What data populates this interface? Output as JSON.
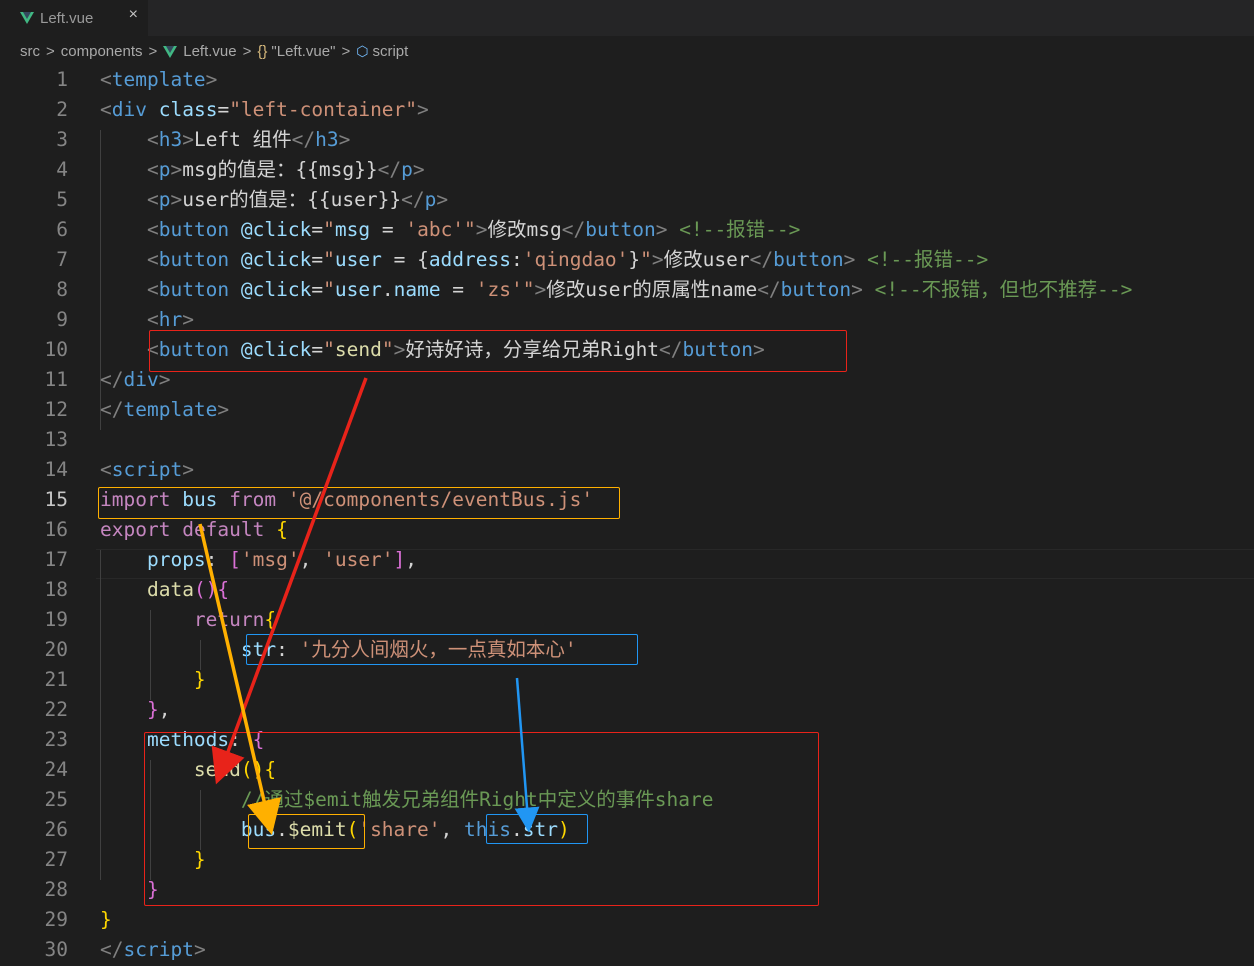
{
  "tab": {
    "title": "Left.vue",
    "close": "×"
  },
  "breadcrumb": {
    "src": "src",
    "components": "components",
    "file": "Left.vue",
    "symbol": "\"Left.vue\"",
    "section": "script",
    "sep": ">"
  },
  "editor": {
    "active_line": 15,
    "lines": [
      [
        [
          "punc",
          "<"
        ],
        [
          "tag",
          "template"
        ],
        [
          "punc",
          ">"
        ]
      ],
      [
        [
          "punc",
          "<"
        ],
        [
          "tag",
          "div"
        ],
        [
          "txt",
          " "
        ],
        [
          "attr",
          "class"
        ],
        [
          "txt",
          "="
        ],
        [
          "str",
          "\"left-container\""
        ],
        [
          "punc",
          ">"
        ]
      ],
      [
        [
          "txt",
          "    "
        ],
        [
          "punc",
          "<"
        ],
        [
          "tag",
          "h3"
        ],
        [
          "punc",
          ">"
        ],
        [
          "txt",
          "Left 组件"
        ],
        [
          "punc",
          "</"
        ],
        [
          "tag",
          "h3"
        ],
        [
          "punc",
          ">"
        ]
      ],
      [
        [
          "txt",
          "    "
        ],
        [
          "punc",
          "<"
        ],
        [
          "tag",
          "p"
        ],
        [
          "punc",
          ">"
        ],
        [
          "txt",
          "msg的值是：{{msg}}"
        ],
        [
          "punc",
          "</"
        ],
        [
          "tag",
          "p"
        ],
        [
          "punc",
          ">"
        ]
      ],
      [
        [
          "txt",
          "    "
        ],
        [
          "punc",
          "<"
        ],
        [
          "tag",
          "p"
        ],
        [
          "punc",
          ">"
        ],
        [
          "txt",
          "user的值是：{{user}}"
        ],
        [
          "punc",
          "</"
        ],
        [
          "tag",
          "p"
        ],
        [
          "punc",
          ">"
        ]
      ],
      [
        [
          "txt",
          "    "
        ],
        [
          "punc",
          "<"
        ],
        [
          "tag",
          "button"
        ],
        [
          "txt",
          " "
        ],
        [
          "attr",
          "@click"
        ],
        [
          "txt",
          "="
        ],
        [
          "str",
          "\""
        ],
        [
          "var",
          "msg"
        ],
        [
          "txt",
          " = "
        ],
        [
          "str",
          "'abc'"
        ],
        [
          "str",
          "\""
        ],
        [
          "punc",
          ">"
        ],
        [
          "txt",
          "修改msg"
        ],
        [
          "punc",
          "</"
        ],
        [
          "tag",
          "button"
        ],
        [
          "punc",
          ">"
        ],
        [
          "txt",
          " "
        ],
        [
          "cmt",
          "<!--报错-->"
        ]
      ],
      [
        [
          "txt",
          "    "
        ],
        [
          "punc",
          "<"
        ],
        [
          "tag",
          "button"
        ],
        [
          "txt",
          " "
        ],
        [
          "attr",
          "@click"
        ],
        [
          "txt",
          "="
        ],
        [
          "str",
          "\""
        ],
        [
          "var",
          "user"
        ],
        [
          "txt",
          " = {"
        ],
        [
          "var",
          "address"
        ],
        [
          "txt",
          ":"
        ],
        [
          "str",
          "'qingdao'"
        ],
        [
          "txt",
          "}"
        ],
        [
          "str",
          "\""
        ],
        [
          "punc",
          ">"
        ],
        [
          "txt",
          "修改user"
        ],
        [
          "punc",
          "</"
        ],
        [
          "tag",
          "button"
        ],
        [
          "punc",
          ">"
        ],
        [
          "txt",
          " "
        ],
        [
          "cmt",
          "<!--报错-->"
        ]
      ],
      [
        [
          "txt",
          "    "
        ],
        [
          "punc",
          "<"
        ],
        [
          "tag",
          "button"
        ],
        [
          "txt",
          " "
        ],
        [
          "attr",
          "@click"
        ],
        [
          "txt",
          "="
        ],
        [
          "str",
          "\""
        ],
        [
          "var",
          "user"
        ],
        [
          "txt",
          "."
        ],
        [
          "var",
          "name"
        ],
        [
          "txt",
          " = "
        ],
        [
          "str",
          "'zs'"
        ],
        [
          "str",
          "\""
        ],
        [
          "punc",
          ">"
        ],
        [
          "txt",
          "修改user的原属性name"
        ],
        [
          "punc",
          "</"
        ],
        [
          "tag",
          "button"
        ],
        [
          "punc",
          ">"
        ],
        [
          "txt",
          " "
        ],
        [
          "cmt",
          "<!--不报错，但也不推荐-->"
        ]
      ],
      [
        [
          "txt",
          "    "
        ],
        [
          "punc",
          "<"
        ],
        [
          "tag",
          "hr"
        ],
        [
          "punc",
          ">"
        ]
      ],
      [
        [
          "txt",
          "    "
        ],
        [
          "punc",
          "<"
        ],
        [
          "tag",
          "button"
        ],
        [
          "txt",
          " "
        ],
        [
          "attr",
          "@click"
        ],
        [
          "txt",
          "="
        ],
        [
          "str",
          "\""
        ],
        [
          "fn",
          "send"
        ],
        [
          "str",
          "\""
        ],
        [
          "punc",
          ">"
        ],
        [
          "txt",
          "好诗好诗，分享给兄弟Right"
        ],
        [
          "punc",
          "</"
        ],
        [
          "tag",
          "button"
        ],
        [
          "punc",
          ">"
        ]
      ],
      [
        [
          "punc",
          "</"
        ],
        [
          "tag",
          "div"
        ],
        [
          "punc",
          ">"
        ]
      ],
      [
        [
          "punc",
          "</"
        ],
        [
          "tag",
          "template"
        ],
        [
          "punc",
          ">"
        ]
      ],
      [],
      [
        [
          "punc",
          "<"
        ],
        [
          "tag",
          "script"
        ],
        [
          "punc",
          ">"
        ]
      ],
      [
        [
          "kw",
          "import"
        ],
        [
          "txt",
          " "
        ],
        [
          "var",
          "bus"
        ],
        [
          "txt",
          " "
        ],
        [
          "kw",
          "from"
        ],
        [
          "txt",
          " "
        ],
        [
          "str",
          "'@/components/eventBus.js'"
        ]
      ],
      [
        [
          "kw",
          "export"
        ],
        [
          "txt",
          " "
        ],
        [
          "kw",
          "default"
        ],
        [
          "txt",
          " "
        ],
        [
          "brace",
          "{"
        ]
      ],
      [
        [
          "txt",
          "    "
        ],
        [
          "var",
          "props"
        ],
        [
          "txt",
          ": "
        ],
        [
          "brace2",
          "["
        ],
        [
          "str",
          "'msg'"
        ],
        [
          "txt",
          ", "
        ],
        [
          "str",
          "'user'"
        ],
        [
          "brace2",
          "]"
        ],
        [
          "txt",
          ","
        ]
      ],
      [
        [
          "txt",
          "    "
        ],
        [
          "fn",
          "data"
        ],
        [
          "brace2",
          "()"
        ],
        [
          "brace2",
          "{"
        ]
      ],
      [
        [
          "txt",
          "        "
        ],
        [
          "kw",
          "return"
        ],
        [
          "brace",
          "{"
        ]
      ],
      [
        [
          "txt",
          "            "
        ],
        [
          "var",
          "str"
        ],
        [
          "txt",
          ": "
        ],
        [
          "str",
          "'九分人间烟火，一点真如本心'"
        ]
      ],
      [
        [
          "txt",
          "        "
        ],
        [
          "brace",
          "}"
        ]
      ],
      [
        [
          "txt",
          "    "
        ],
        [
          "brace2",
          "}"
        ],
        [
          "txt",
          ","
        ]
      ],
      [
        [
          "txt",
          "    "
        ],
        [
          "var",
          "methods"
        ],
        [
          "txt",
          ": "
        ],
        [
          "brace2",
          "{"
        ]
      ],
      [
        [
          "txt",
          "        "
        ],
        [
          "fn",
          "send"
        ],
        [
          "brace",
          "()"
        ],
        [
          "brace",
          "{"
        ]
      ],
      [
        [
          "txt",
          "            "
        ],
        [
          "cmt",
          "//通过$emit触发兄弟组件Right中定义的事件share"
        ]
      ],
      [
        [
          "txt",
          "            "
        ],
        [
          "var",
          "bus"
        ],
        [
          "txt",
          "."
        ],
        [
          "fn",
          "$emit"
        ],
        [
          "brace",
          "("
        ],
        [
          "str",
          "'share'"
        ],
        [
          "txt",
          ", "
        ],
        [
          "sto",
          "this"
        ],
        [
          "txt",
          "."
        ],
        [
          "var",
          "str"
        ],
        [
          "brace",
          ")"
        ]
      ],
      [
        [
          "txt",
          "        "
        ],
        [
          "brace",
          "}"
        ]
      ],
      [
        [
          "txt",
          "    "
        ],
        [
          "brace2",
          "}"
        ]
      ],
      [
        [
          "brace",
          "}"
        ]
      ],
      [
        [
          "punc",
          "</"
        ],
        [
          "tag",
          "script"
        ],
        [
          "punc",
          ">"
        ]
      ]
    ]
  },
  "annotation_colors": {
    "red": "#e8231a",
    "orange": "#ffb000",
    "blue": "#2196f3"
  }
}
